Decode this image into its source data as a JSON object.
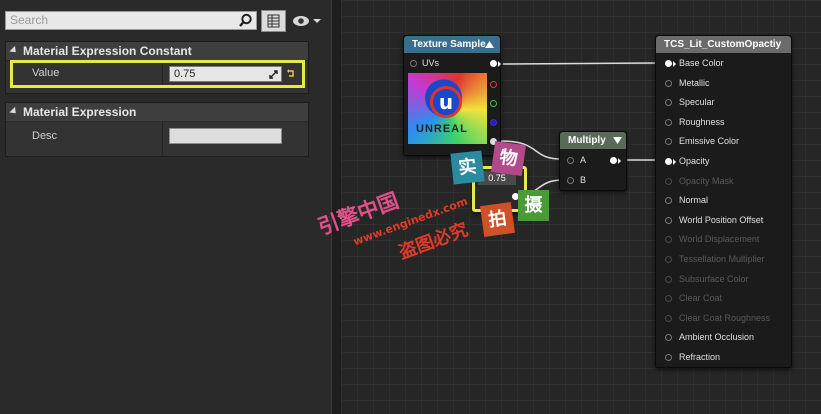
{
  "details": {
    "search_placeholder": "Search",
    "sections": [
      {
        "title": "Material Expression Constant",
        "property_label": "Value",
        "property_value": "0.75"
      },
      {
        "title": "Material Expression",
        "property_label": "Desc",
        "property_value": ""
      }
    ],
    "highlight_color": "#e7e84a"
  },
  "graph": {
    "texture_node": {
      "title": "Texture Sample",
      "title_color": "#3a6e8f",
      "input_label": "UVs",
      "thumb_text": "UNREAL"
    },
    "constant_node": {
      "value": "0.75",
      "highlight_color": "#e7e84a"
    },
    "multiply_node": {
      "title": "Multiply",
      "title_color": "#5a6a58",
      "inputs": [
        "A",
        "B"
      ]
    },
    "result_node": {
      "title": "TCS_Lit_CustomOpactiy",
      "title_color": "#6b6b6b",
      "pins": [
        {
          "label": "Base Color",
          "active": true,
          "connected": true
        },
        {
          "label": "Metallic",
          "active": true,
          "connected": false
        },
        {
          "label": "Specular",
          "active": true,
          "connected": false
        },
        {
          "label": "Roughness",
          "active": true,
          "connected": false
        },
        {
          "label": "Emissive Color",
          "active": true,
          "connected": false
        },
        {
          "label": "Opacity",
          "active": true,
          "connected": true
        },
        {
          "label": "Opacity Mask",
          "active": false,
          "connected": false
        },
        {
          "label": "Normal",
          "active": true,
          "connected": false
        },
        {
          "label": "World Position Offset",
          "active": true,
          "connected": false
        },
        {
          "label": "World Displacement",
          "active": false,
          "connected": false
        },
        {
          "label": "Tessellation Multiplier",
          "active": false,
          "connected": false
        },
        {
          "label": "Subsurface Color",
          "active": false,
          "connected": false
        },
        {
          "label": "Clear Coat",
          "active": false,
          "connected": false
        },
        {
          "label": "Clear Coat Roughness",
          "active": false,
          "connected": false
        },
        {
          "label": "Ambient Occlusion",
          "active": true,
          "connected": false
        },
        {
          "label": "Refraction",
          "active": true,
          "connected": false
        }
      ]
    }
  },
  "watermark": {
    "stamp_chars": [
      "实",
      "物",
      "拍",
      "摄"
    ],
    "brand": "引擎中国",
    "url": "www.enginedx.com",
    "notice": "盗图必究",
    "brand_color": "#e0508a",
    "notice_color": "#e03a2a"
  }
}
